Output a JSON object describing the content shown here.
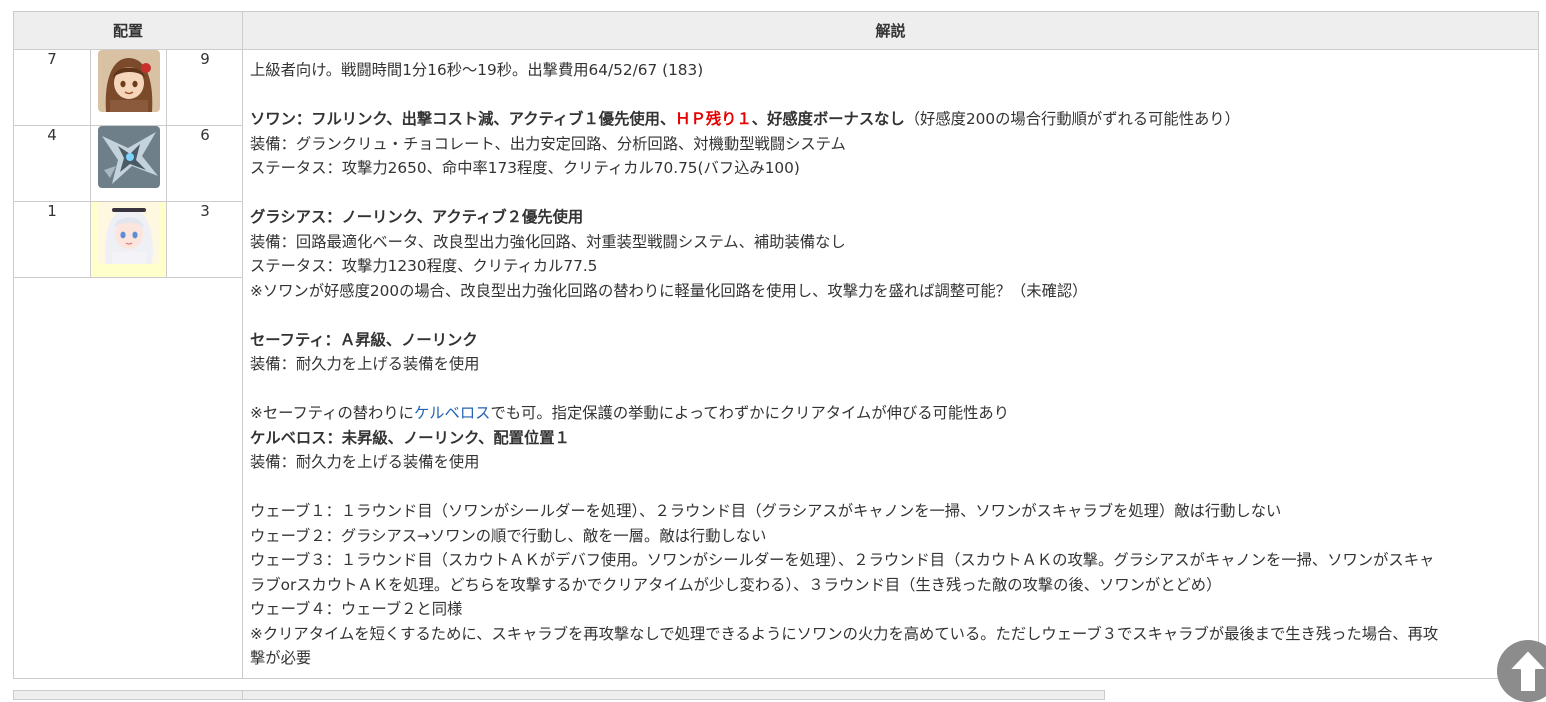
{
  "table": {
    "header_placement": "配置",
    "header_description": "解説"
  },
  "placement_rows": [
    {
      "left": "7",
      "right": "9",
      "portrait": "brown-haired-girl-portrait",
      "highlight": false
    },
    {
      "left": "4",
      "right": "6",
      "portrait": "mechanical-dragon-portrait",
      "highlight": false
    },
    {
      "left": "1",
      "right": "3",
      "portrait": "white-haired-girl-portrait",
      "highlight": true
    }
  ],
  "description": {
    "line01": "上級者向け。戦闘時間1分16秒～19秒。出撃費用64/52/67 (183)",
    "swon_head_a": "ソワン：フルリンク、出撃コスト減、アクティブ１優先使用、",
    "swon_head_red": "ＨＰ残り１",
    "swon_head_b": "、好感度ボーナスなし",
    "swon_note": "（好感度200の場合行動順がずれる可能性あり）",
    "swon_equip": "装備：グランクリュ・チョコレート、出力安定回路、分析回路、対機動型戦闘システム",
    "swon_status": "ステータス：攻撃力2650、命中率173程度、クリティカル70.75(バフ込み100)",
    "grasias_head": "グラシアス：ノーリンク、アクティブ２優先使用",
    "grasias_equip": "装備：回路最適化ベータ、改良型出力強化回路、対重装型戦闘システム、補助装備なし",
    "grasias_status": "ステータス：攻撃力1230程度、クリティカル77.5",
    "grasias_note": "※ソワンが好感度200の場合、改良型出力強化回路の替わりに軽量化回路を使用し、攻撃力を盛れば調整可能？（未確認）",
    "safety_head": "セーフティ：Ａ昇級、ノーリンク",
    "safety_equip": "装備：耐久力を上げる装備を使用",
    "alt_note_a": "※セーフティの替わりに",
    "alt_note_link": "ケルベロス",
    "alt_note_b": "でも可。指定保護の挙動によってわずかにクリアタイムが伸びる可能性あり",
    "kerberos_head": "ケルベロス：未昇級、ノーリンク、配置位置１",
    "kerberos_equip": "装備：耐久力を上げる装備を使用",
    "wave1": "ウェーブ１：１ラウンド目（ソワンがシールダーを処理）、２ラウンド目（グラシアスがキャノンを一掃、ソワンがスキャラブを処理）敵は行動しない",
    "wave2": "ウェーブ２：グラシアス→ソワンの順で行動し、敵を一層。敵は行動しない",
    "wave3a": "ウェーブ３：１ラウンド目（スカウトＡＫがデバフ使用。ソワンがシールダーを処理）、２ラウンド目（スカウトＡＫの攻撃。グラシアスがキャノンを一掃、ソワンがスキャ",
    "wave3b": "ラブorスカウトＡＫを処理。どちらを攻撃するかでクリアタイムが少し変わる）、３ラウンド目（生き残った敵の攻撃の後、ソワンがとどめ）",
    "wave4": "ウェーブ４：ウェーブ２と同様",
    "final_a": "※クリアタイムを短くするために、スキャラブを再攻撃なしで処理できるようにソワンの火力を高めている。ただしウェーブ３でスキャラブが最後まで生き残った場合、再攻",
    "final_b": "撃が必要"
  },
  "colors": {
    "header_bg": "#eeeeee",
    "border": "#cccccc",
    "highlight_red": "#e60000",
    "link_blue": "#2563b8",
    "portrait_highlight_bg": "#ffffcc",
    "scroll_button": "#8c8c8c"
  },
  "scroll_top_icon": "arrow-up-icon"
}
